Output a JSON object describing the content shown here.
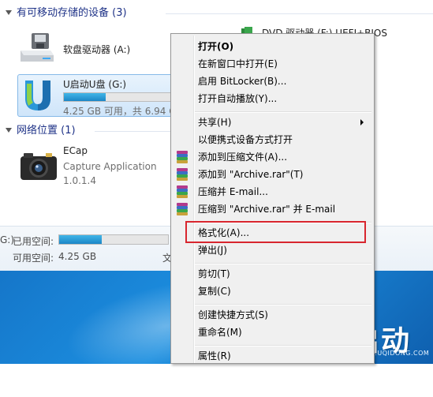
{
  "explorer": {
    "removable_header": "有可移动存储的设备 (3)",
    "network_header": "网络位置 (1)",
    "floppy": {
      "name": "软盘驱动器 (A:)"
    },
    "dvd": {
      "name": "DVD 驱动器 (F:) UEFI+BIOS"
    },
    "usb": {
      "name": "U启动U盘 (G:)",
      "usage": "4.25 GB 可用，共 6.94 G",
      "fill_fraction": 0.39
    },
    "ecap": {
      "name": "ECap",
      "description": "Capture Application",
      "version": "1.0.1.4"
    }
  },
  "details": {
    "drive_letter_fragment": "G:)",
    "used_label": "已用空间:",
    "free_label": "可用空间:",
    "free_value": "4.25 GB",
    "right_fragment": "文",
    "used_fill_fraction": 0.39
  },
  "context_menu": {
    "open": "打开(O)",
    "open_new_window": "在新窗口中打开(E)",
    "bitlocker": "启用 BitLocker(B)...",
    "autoplay": "打开自动播放(Y)...",
    "share": "共享(H)",
    "portable_open": "以便携式设备方式打开",
    "add_to_archive": "添加到压缩文件(A)...",
    "add_to_rar": "添加到 \"Archive.rar\"(T)",
    "compress_email": "压缩并 E-mail...",
    "compress_rar_email": "压缩到 \"Archive.rar\" 并 E-mail",
    "format": "格式化(A)...",
    "eject": "弹出(J)",
    "cut": "剪切(T)",
    "copy": "复制(C)",
    "create_shortcut": "创建快捷方式(S)",
    "rename": "重命名(M)",
    "properties": "属性(R)"
  },
  "logo": {
    "brand_text": "启动",
    "url": "WWW.UQIDONG.COM"
  },
  "colors": {
    "highlight_border": "#d8262e",
    "progress_fill": "#1b86c6",
    "desktop": "#1c8fe0",
    "header_text": "#1e3287"
  }
}
